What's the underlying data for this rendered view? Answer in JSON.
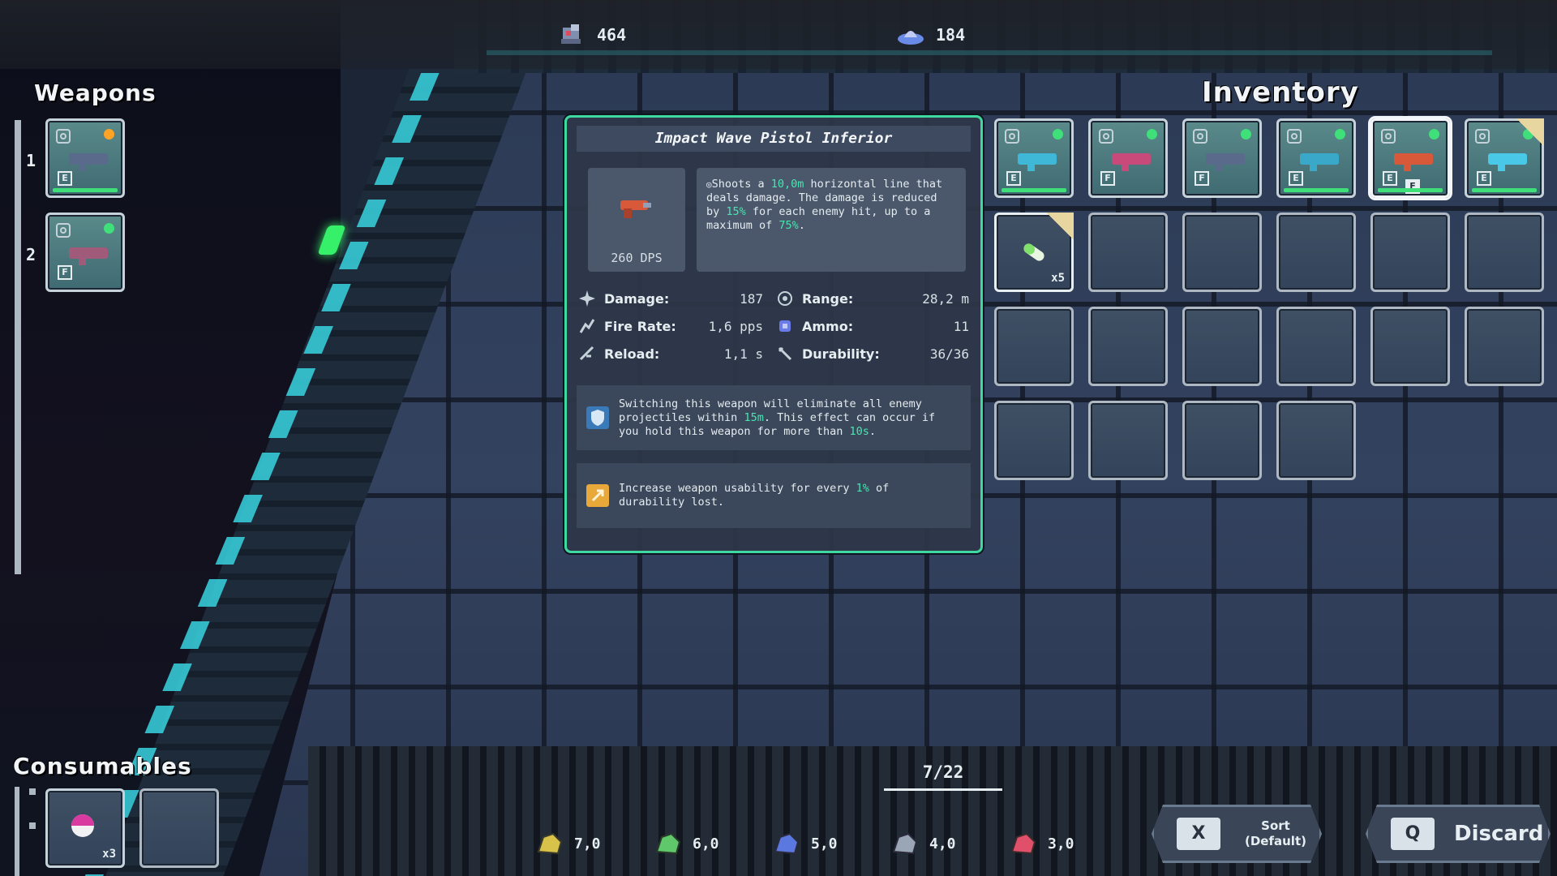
{
  "resources": [
    {
      "icon": "robot-scrap-icon",
      "value": "464"
    },
    {
      "icon": "ufo-crystal-icon",
      "value": "184"
    }
  ],
  "weapons": {
    "title": "Weapons",
    "slots": [
      {
        "number": "1",
        "key": "E",
        "status": "orange"
      },
      {
        "number": "2",
        "key": "F",
        "status": "green"
      }
    ]
  },
  "inventory": {
    "title": "Inventory",
    "capacity": "7/22",
    "weapon_items": [
      {
        "key": "E",
        "gun_color": "#3fb8d8"
      },
      {
        "key": "F",
        "gun_color": "#c84a7a"
      },
      {
        "key": "F",
        "gun_color": "#5a6a8a"
      },
      {
        "key": "E",
        "gun_color": "#3aa8c8"
      },
      {
        "key": "E",
        "gun_color": "#d8583a",
        "selected": true,
        "equip_hint": "F"
      },
      {
        "key": "E",
        "gun_color": "#4ac8e8",
        "new": true
      }
    ],
    "consumable_item": {
      "count": "x5",
      "new": true
    }
  },
  "tooltip": {
    "name": "Impact Wave Pistol Inferior",
    "dps": "260 DPS",
    "description_parts": {
      "p1": "Shoots a ",
      "h1": "10,0m",
      "p2": " horizontal line that deals damage. The damage is reduced by ",
      "h2": "15%",
      "p3": " for each enemy hit, up to a maximum of ",
      "h3": "75%",
      "p4": "."
    },
    "stats": {
      "damage": {
        "label": "Damage:",
        "value": "187"
      },
      "range": {
        "label": "Range:",
        "value": "28,2 m"
      },
      "fire_rate": {
        "label": "Fire Rate:",
        "value": "1,6 pps"
      },
      "ammo": {
        "label": "Ammo:",
        "value": "11"
      },
      "reload": {
        "label": "Reload:",
        "value": "1,1 s"
      },
      "durability": {
        "label": "Durability:",
        "value": "36/36"
      }
    },
    "perk1": {
      "p1": "Switching this weapon will eliminate all enemy projectiles within ",
      "h1": "15m",
      "p2": ". This effect can occur if you hold this weapon for more than ",
      "h2": "10s",
      "p3": "."
    },
    "perk2": {
      "p1": "Increase weapon usability for every ",
      "h1": "1%",
      "p2": " of durability lost."
    }
  },
  "consumables": {
    "title": "Consumables",
    "item": {
      "count": "x3"
    }
  },
  "materials": [
    {
      "icon": "gold-ore-icon",
      "value": "7,0",
      "color": "#d8c24a"
    },
    {
      "icon": "green-ore-icon",
      "value": "6,0",
      "color": "#5fc86a"
    },
    {
      "icon": "blue-ore-icon",
      "value": "5,0",
      "color": "#5a78e0"
    },
    {
      "icon": "grey-ore-icon",
      "value": "4,0",
      "color": "#9aa6b6"
    },
    {
      "icon": "red-ore-icon",
      "value": "3,0",
      "color": "#e0506a"
    }
  ],
  "buttons": {
    "sort": {
      "key": "X",
      "label_line1": "Sort",
      "label_line2": "(Default)"
    },
    "discard": {
      "key": "Q",
      "label": "Discard"
    }
  },
  "colors": {
    "accent": "#3dd9a0",
    "highlight": "#47e6b0",
    "slot_border": "#aeb8c3"
  }
}
